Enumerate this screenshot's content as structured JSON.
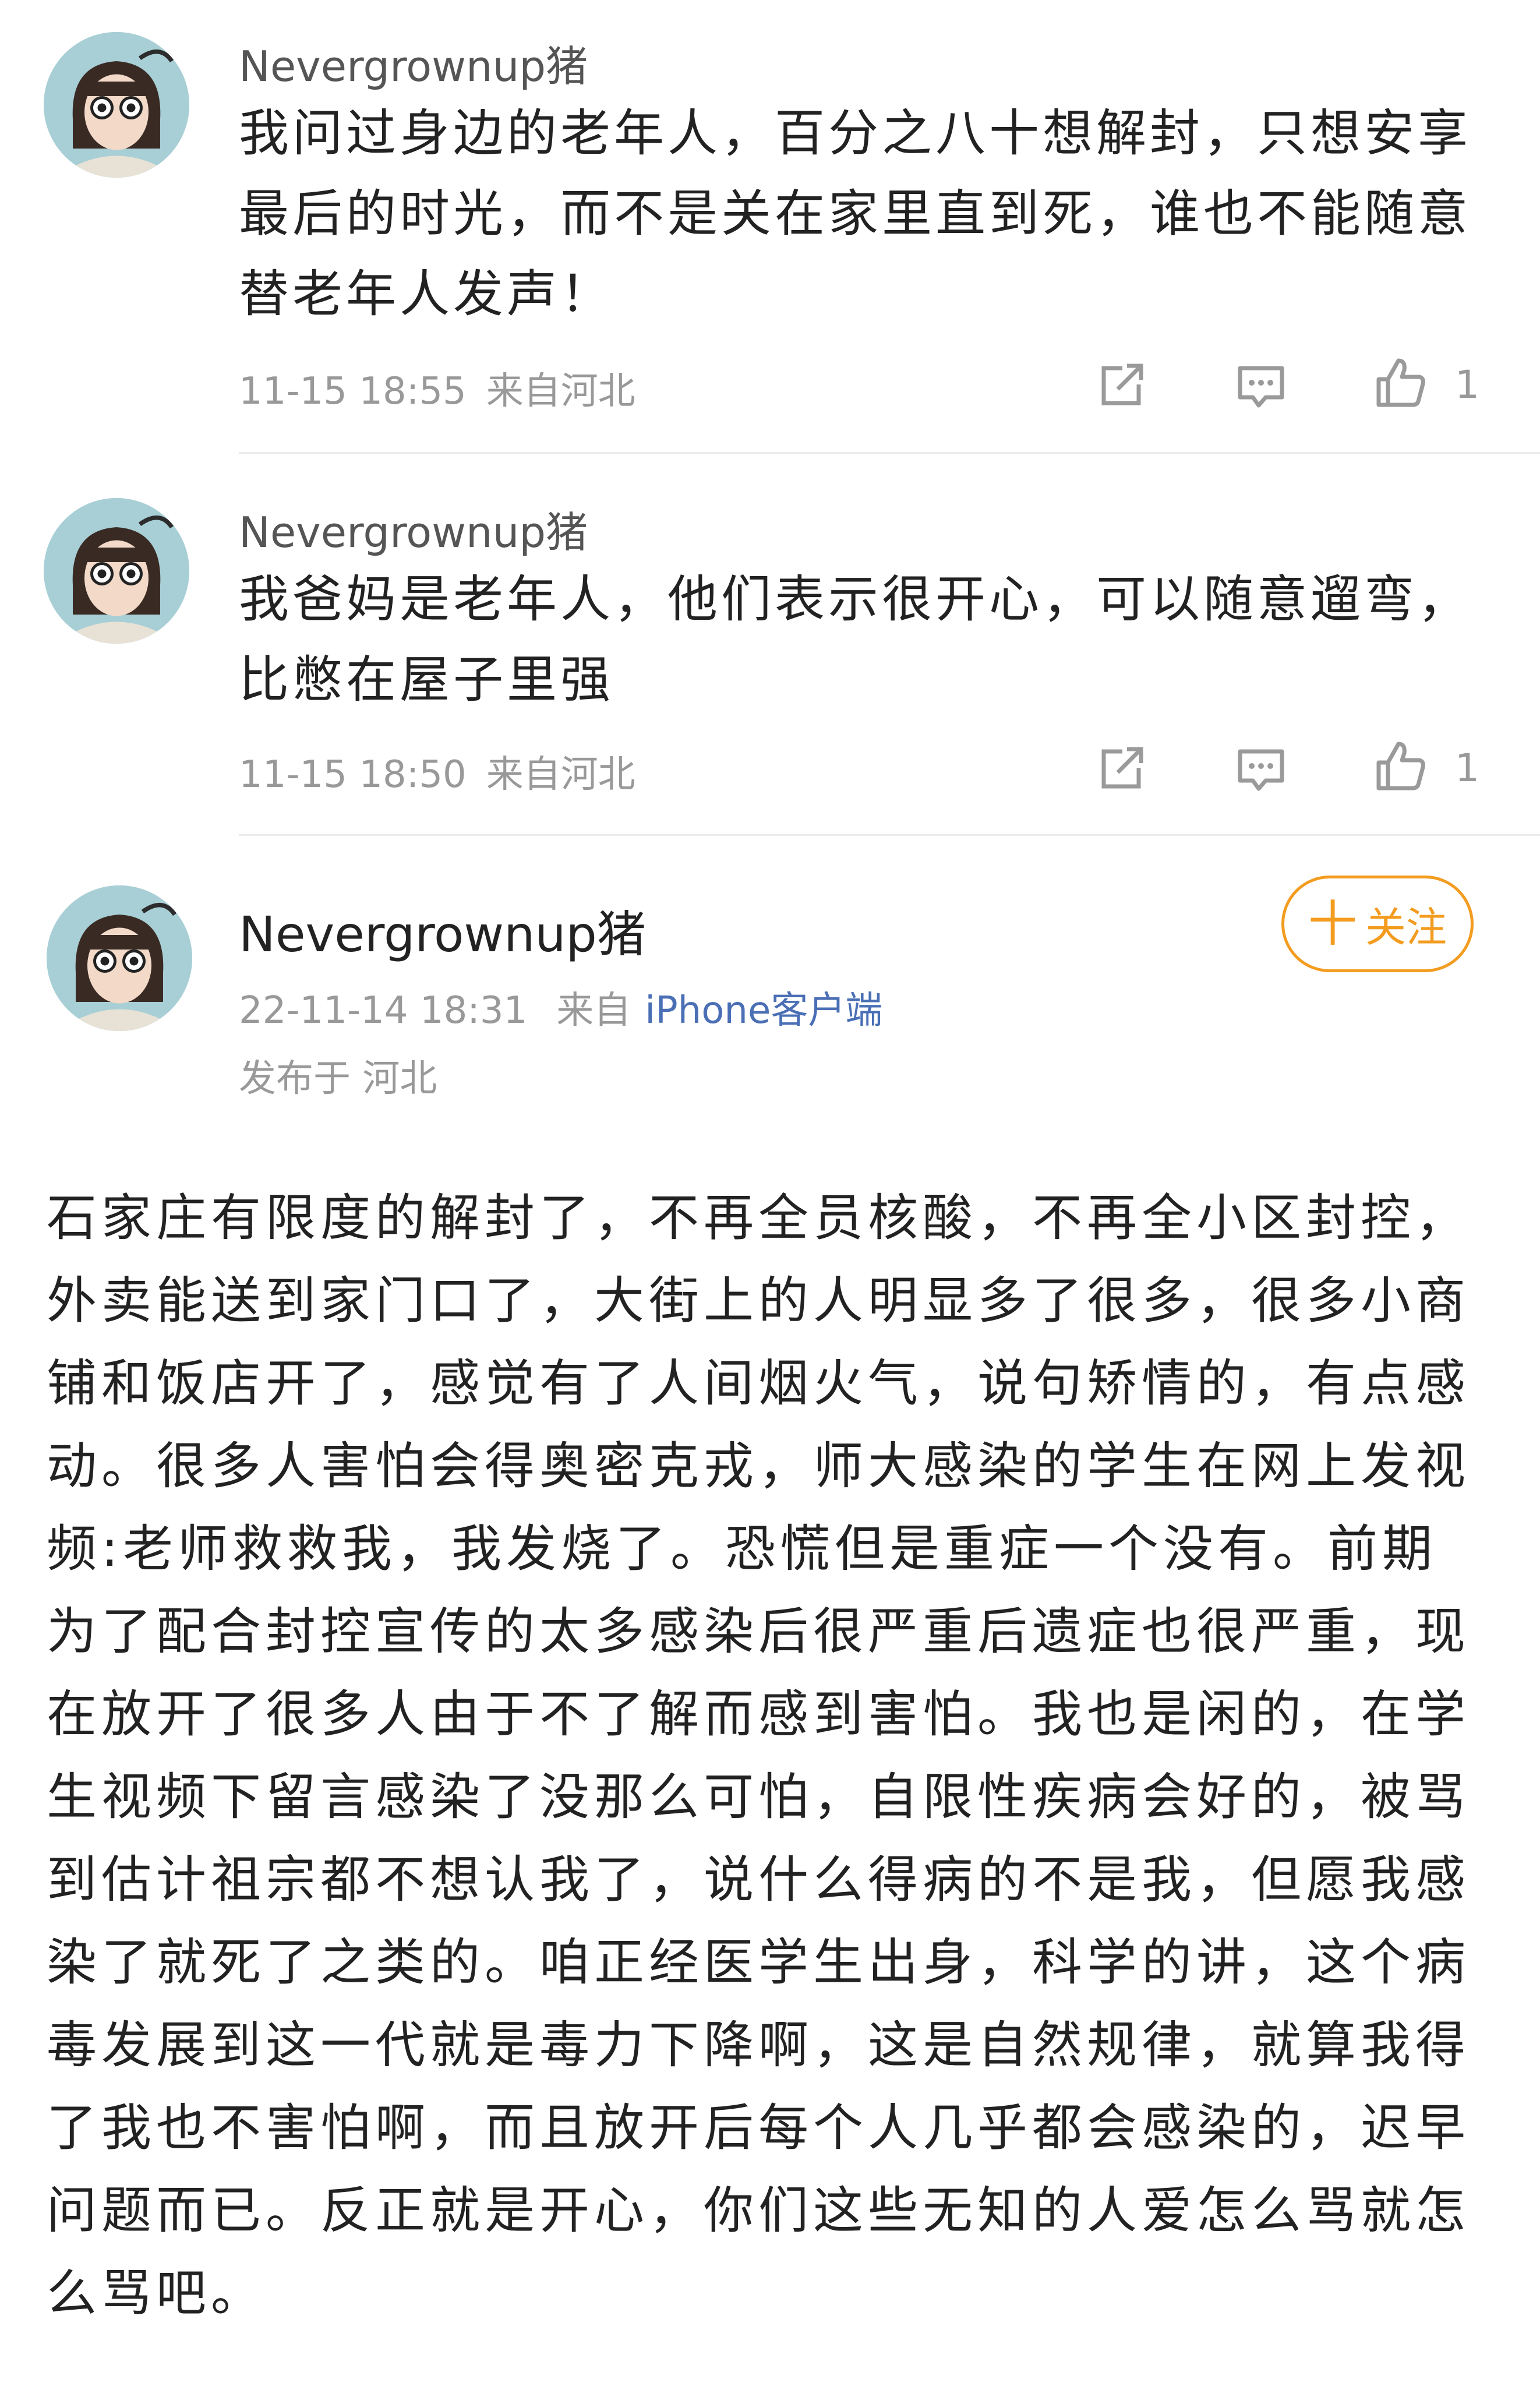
{
  "comments": [
    {
      "username": "Nevergrownup猪",
      "text": "我问过身边的老年人，百分之八十想解封，只想安享最后的时光，而不是关在家里直到死，谁也不能随意替老年人发声！",
      "time": "11-15 18:55",
      "location": "来自河北",
      "likes": "1"
    },
    {
      "username": "Nevergrownup猪",
      "text": "我爸妈是老年人，他们表示很开心，可以随意遛弯，比憋在屋子里强",
      "time": "11-15 18:50",
      "location": "来自河北",
      "likes": "1"
    }
  ],
  "post": {
    "username": "Nevergrownup猪",
    "follow_label": "关注",
    "follow_plus": "十",
    "time": "22-11-14 18:31",
    "source_prefix": "来自",
    "source": "iPhone客户端",
    "location": "发布于 河北",
    "body": "石家庄有限度的解封了，不再全员核酸，不再全小区封控，外卖能送到家门口了，大街上的人明显多了很多，很多小商铺和饭店开了，感觉有了人间烟火气，说句矫情的，有点感动。很多人害怕会得奥密克戎，师大感染的学生在网上发视频:老师救救我，我发烧了。恐慌但是重症一个没有。前期为了配合封控宣传的太多感染后很严重后遗症也很严重，现在放开了很多人由于不了解而感到害怕。我也是闲的，在学生视频下留言感染了没那么可怕，自限性疾病会好的，被骂到估计祖宗都不想认我了，说什么得病的不是我，但愿我感染了就死了之类的。咱正经医学生出身，科学的讲，这个病毒发展到这一代就是毒力下降啊，这是自然规律，就算我得了我也不害怕啊，而且放开后每个人几乎都会感染的，迟早问题而已。反正就是开心，你们这些无知的人爱怎么骂就怎么骂吧。"
  },
  "icons": {
    "share": "share-icon",
    "comment": "comment-icon",
    "like": "thumbs-up-icon",
    "avatar": "avatar"
  },
  "colors": {
    "accent": "#f39c1f",
    "link": "#4a6fb5",
    "meta": "#999999"
  }
}
